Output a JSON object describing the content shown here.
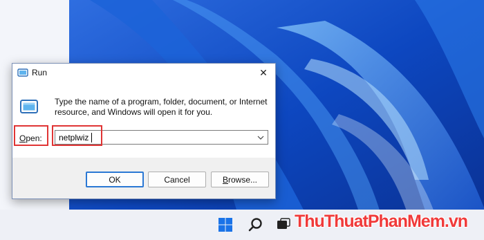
{
  "dialog": {
    "title": "Run",
    "close_glyph": "✕",
    "description": "Type the name of a program, folder, document, or Internet resource, and Windows will open it for you.",
    "open_label_key": "O",
    "open_label_rest": "pen:",
    "input_value": "netplwiz",
    "buttons": {
      "ok": "OK",
      "cancel": "Cancel",
      "browse_key": "B",
      "browse_rest": "rowse..."
    }
  },
  "taskbar": {
    "icons": [
      "windows-start-icon",
      "search-icon",
      "task-view-icon"
    ]
  },
  "watermark": {
    "text": "ThuThuatPhanMem.vn"
  },
  "colors": {
    "wallpaper_blue": "#1356c9",
    "highlight_red": "#e03434",
    "ok_border": "#2a78d4"
  }
}
